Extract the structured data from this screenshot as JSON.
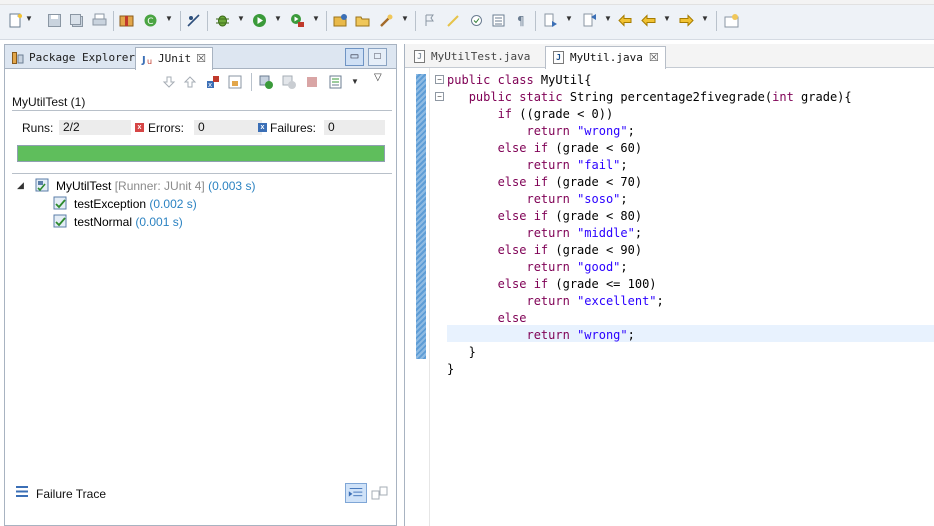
{
  "toolbar": {
    "icons": [
      "new-icon",
      "save-icon",
      "save-all-icon",
      "print-icon",
      "package-icon",
      "refresh-icon",
      "skip-breakpoints-icon",
      "debug-icon",
      "run-icon",
      "run-external-icon",
      "open-type-icon",
      "open-folder-icon",
      "search-icon",
      "toggle-mark-icon",
      "pen-icon",
      "task-icon",
      "block-selection-icon",
      "whitespace-icon",
      "next-annotation-icon",
      "prev-annotation-icon",
      "last-edit-icon",
      "back-icon",
      "forward-icon",
      "perspective-icon"
    ]
  },
  "left_panel": {
    "tabs": [
      {
        "label": "Package Explorer",
        "icon": "package-explorer-icon",
        "active": false
      },
      {
        "label": "JUnit",
        "icon": "junit-icon",
        "active": true,
        "close": "☒"
      }
    ],
    "junit": {
      "title": "MyUtilTest (1)",
      "runs_label": "Runs:",
      "runs_value": "2/2",
      "errors_label": "Errors:",
      "errors_value": "0",
      "failures_label": "Failures:",
      "failures_value": "0",
      "progress_fraction": 1.0,
      "progress_color": "#5fbe5c",
      "tree": {
        "root": {
          "name": "MyUtilTest",
          "runner": "[Runner: JUnit 4]",
          "time": "(0.003 s)"
        },
        "children": [
          {
            "name": "testException",
            "time": "(0.002 s)"
          },
          {
            "name": "testNormal",
            "time": "(0.001 s)"
          }
        ]
      },
      "failure_trace_label": "Failure Trace"
    }
  },
  "editor": {
    "tabs": [
      {
        "label": "MyUtilTest.java",
        "active": false
      },
      {
        "label": "MyUtil.java",
        "active": true,
        "close": "☒"
      }
    ],
    "code_lines": [
      [
        {
          "t": "public class ",
          "c": "kw"
        },
        {
          "t": "MyUtil{",
          "c": ""
        }
      ],
      [
        {
          "t": "   ",
          "c": ""
        },
        {
          "t": "public static ",
          "c": "kw"
        },
        {
          "t": "String percentage2fivegrade(",
          "c": ""
        },
        {
          "t": "int ",
          "c": "kw"
        },
        {
          "t": "grade){",
          "c": ""
        }
      ],
      [
        {
          "t": "       ",
          "c": ""
        },
        {
          "t": "if ",
          "c": "kw"
        },
        {
          "t": "((grade < 0))",
          "c": ""
        }
      ],
      [
        {
          "t": "           ",
          "c": ""
        },
        {
          "t": "return ",
          "c": "kw"
        },
        {
          "t": "\"wrong\"",
          "c": "str"
        },
        {
          "t": ";",
          "c": ""
        }
      ],
      [
        {
          "t": "       ",
          "c": ""
        },
        {
          "t": "else if ",
          "c": "kw"
        },
        {
          "t": "(grade < 60)",
          "c": ""
        }
      ],
      [
        {
          "t": "           ",
          "c": ""
        },
        {
          "t": "return ",
          "c": "kw"
        },
        {
          "t": "\"fail\"",
          "c": "str"
        },
        {
          "t": ";",
          "c": ""
        }
      ],
      [
        {
          "t": "       ",
          "c": ""
        },
        {
          "t": "else if ",
          "c": "kw"
        },
        {
          "t": "(grade < 70)",
          "c": ""
        }
      ],
      [
        {
          "t": "           ",
          "c": ""
        },
        {
          "t": "return ",
          "c": "kw"
        },
        {
          "t": "\"soso\"",
          "c": "str"
        },
        {
          "t": ";",
          "c": ""
        }
      ],
      [
        {
          "t": "       ",
          "c": ""
        },
        {
          "t": "else if ",
          "c": "kw"
        },
        {
          "t": "(grade < 80)",
          "c": ""
        }
      ],
      [
        {
          "t": "           ",
          "c": ""
        },
        {
          "t": "return ",
          "c": "kw"
        },
        {
          "t": "\"middle\"",
          "c": "str"
        },
        {
          "t": ";",
          "c": ""
        }
      ],
      [
        {
          "t": "       ",
          "c": ""
        },
        {
          "t": "else if ",
          "c": "kw"
        },
        {
          "t": "(grade < 90)",
          "c": ""
        }
      ],
      [
        {
          "t": "           ",
          "c": ""
        },
        {
          "t": "return ",
          "c": "kw"
        },
        {
          "t": "\"good\"",
          "c": "str"
        },
        {
          "t": ";",
          "c": ""
        }
      ],
      [
        {
          "t": "       ",
          "c": ""
        },
        {
          "t": "else if ",
          "c": "kw"
        },
        {
          "t": "(grade <= 100)",
          "c": ""
        }
      ],
      [
        {
          "t": "           ",
          "c": ""
        },
        {
          "t": "return ",
          "c": "kw"
        },
        {
          "t": "\"excellent\"",
          "c": "str"
        },
        {
          "t": ";",
          "c": ""
        }
      ],
      [
        {
          "t": "       ",
          "c": ""
        },
        {
          "t": "else",
          "c": "kw"
        }
      ],
      [
        {
          "t": "           ",
          "c": ""
        },
        {
          "t": "return ",
          "c": "kw"
        },
        {
          "t": "\"wrong\"",
          "c": "str"
        },
        {
          "t": ";",
          "c": ""
        }
      ],
      [
        {
          "t": "   }",
          "c": ""
        }
      ],
      [
        {
          "t": "}",
          "c": ""
        }
      ]
    ]
  }
}
